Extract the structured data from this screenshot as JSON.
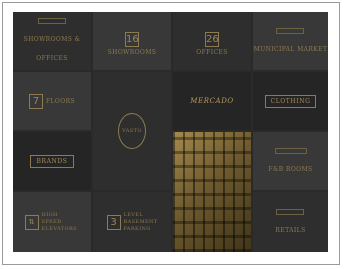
{
  "tiles": {
    "showrooms_offices": "SHOWROOMS & OFFICES",
    "showrooms_count": "16",
    "showrooms_label": "SHOWROOMS",
    "offices_count": "26",
    "offices_label": "OFFICES",
    "municipal_market": "MUNICIPAL MARKET",
    "floors_count": "7",
    "floors_label": "FLOORS",
    "vasto_logo": "VASTO",
    "mercado": "MERCADO",
    "clothing": "CLOTHING",
    "brands": "BRANDS",
    "elevators": "HIGH SPEED ELEVATORS",
    "parking_count": "3",
    "parking_label": "LEVEL BASEMENT PARKING",
    "fl_rooms": "F&B ROOMS",
    "retails": "RETAILS"
  },
  "colors": {
    "background": "#2b2a2a",
    "gold": "#8d7a4f",
    "tile_dark": "#2f2e2e",
    "tile_mid": "#393838"
  }
}
